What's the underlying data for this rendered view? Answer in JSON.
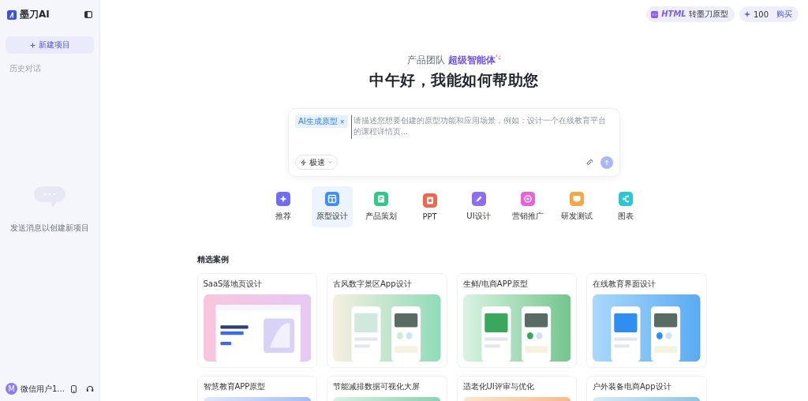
{
  "sidebar": {
    "logo": "墨刀AI",
    "new_button": "新建项目",
    "history_label": "历史对话",
    "empty_text": "发送消息以创建新项目",
    "user": {
      "avatar": "M",
      "name": "微信用户1..."
    }
  },
  "top_bar": {
    "convert_button": "*HTML* 转墨刀原型",
    "credits": "100",
    "buy_link": "购买"
  },
  "hero": {
    "subtitle": "产品团队 **超级智能体**",
    "title": "中午好，我能如何帮助您"
  },
  "composer": {
    "chip": "AI生成原型",
    "chip_close": "×",
    "placeholder": "请描述您想要创建的原型功能和应用场景，例如：设计一个在线教育平台的课程详情页...",
    "mode": "极速"
  },
  "categories": [
    {
      "label": "推荐",
      "selected": false,
      "color": "#6f6cf6"
    },
    {
      "label": "原型设计",
      "selected": true,
      "color": "#3d8ef6"
    },
    {
      "label": "产品策划",
      "selected": false,
      "color": "#2fc98b"
    },
    {
      "label": "PPT",
      "selected": false,
      "color": "#f2654c"
    },
    {
      "label": "UI设计",
      "selected": false,
      "color": "#8d6ef2"
    },
    {
      "label": "营销推广",
      "selected": false,
      "color": "#e862d9"
    },
    {
      "label": "研发测试",
      "selected": false,
      "color": "#f5a743"
    },
    {
      "label": "图表",
      "selected": false,
      "color": "#2cc5d6"
    }
  ],
  "featured": {
    "heading": "精选案例",
    "cases": [
      {
        "title": "SaaS落地页设计"
      },
      {
        "title": "古风数字景区App设计"
      },
      {
        "title": "生鲜/电商APP原型"
      },
      {
        "title": "在线教育界面设计"
      },
      {
        "title": "智慧教育APP原型"
      },
      {
        "title": "节能减排数据可视化大屏"
      },
      {
        "title": "适老化UI评审与优化"
      },
      {
        "title": "户外装备电商App设计"
      }
    ]
  }
}
